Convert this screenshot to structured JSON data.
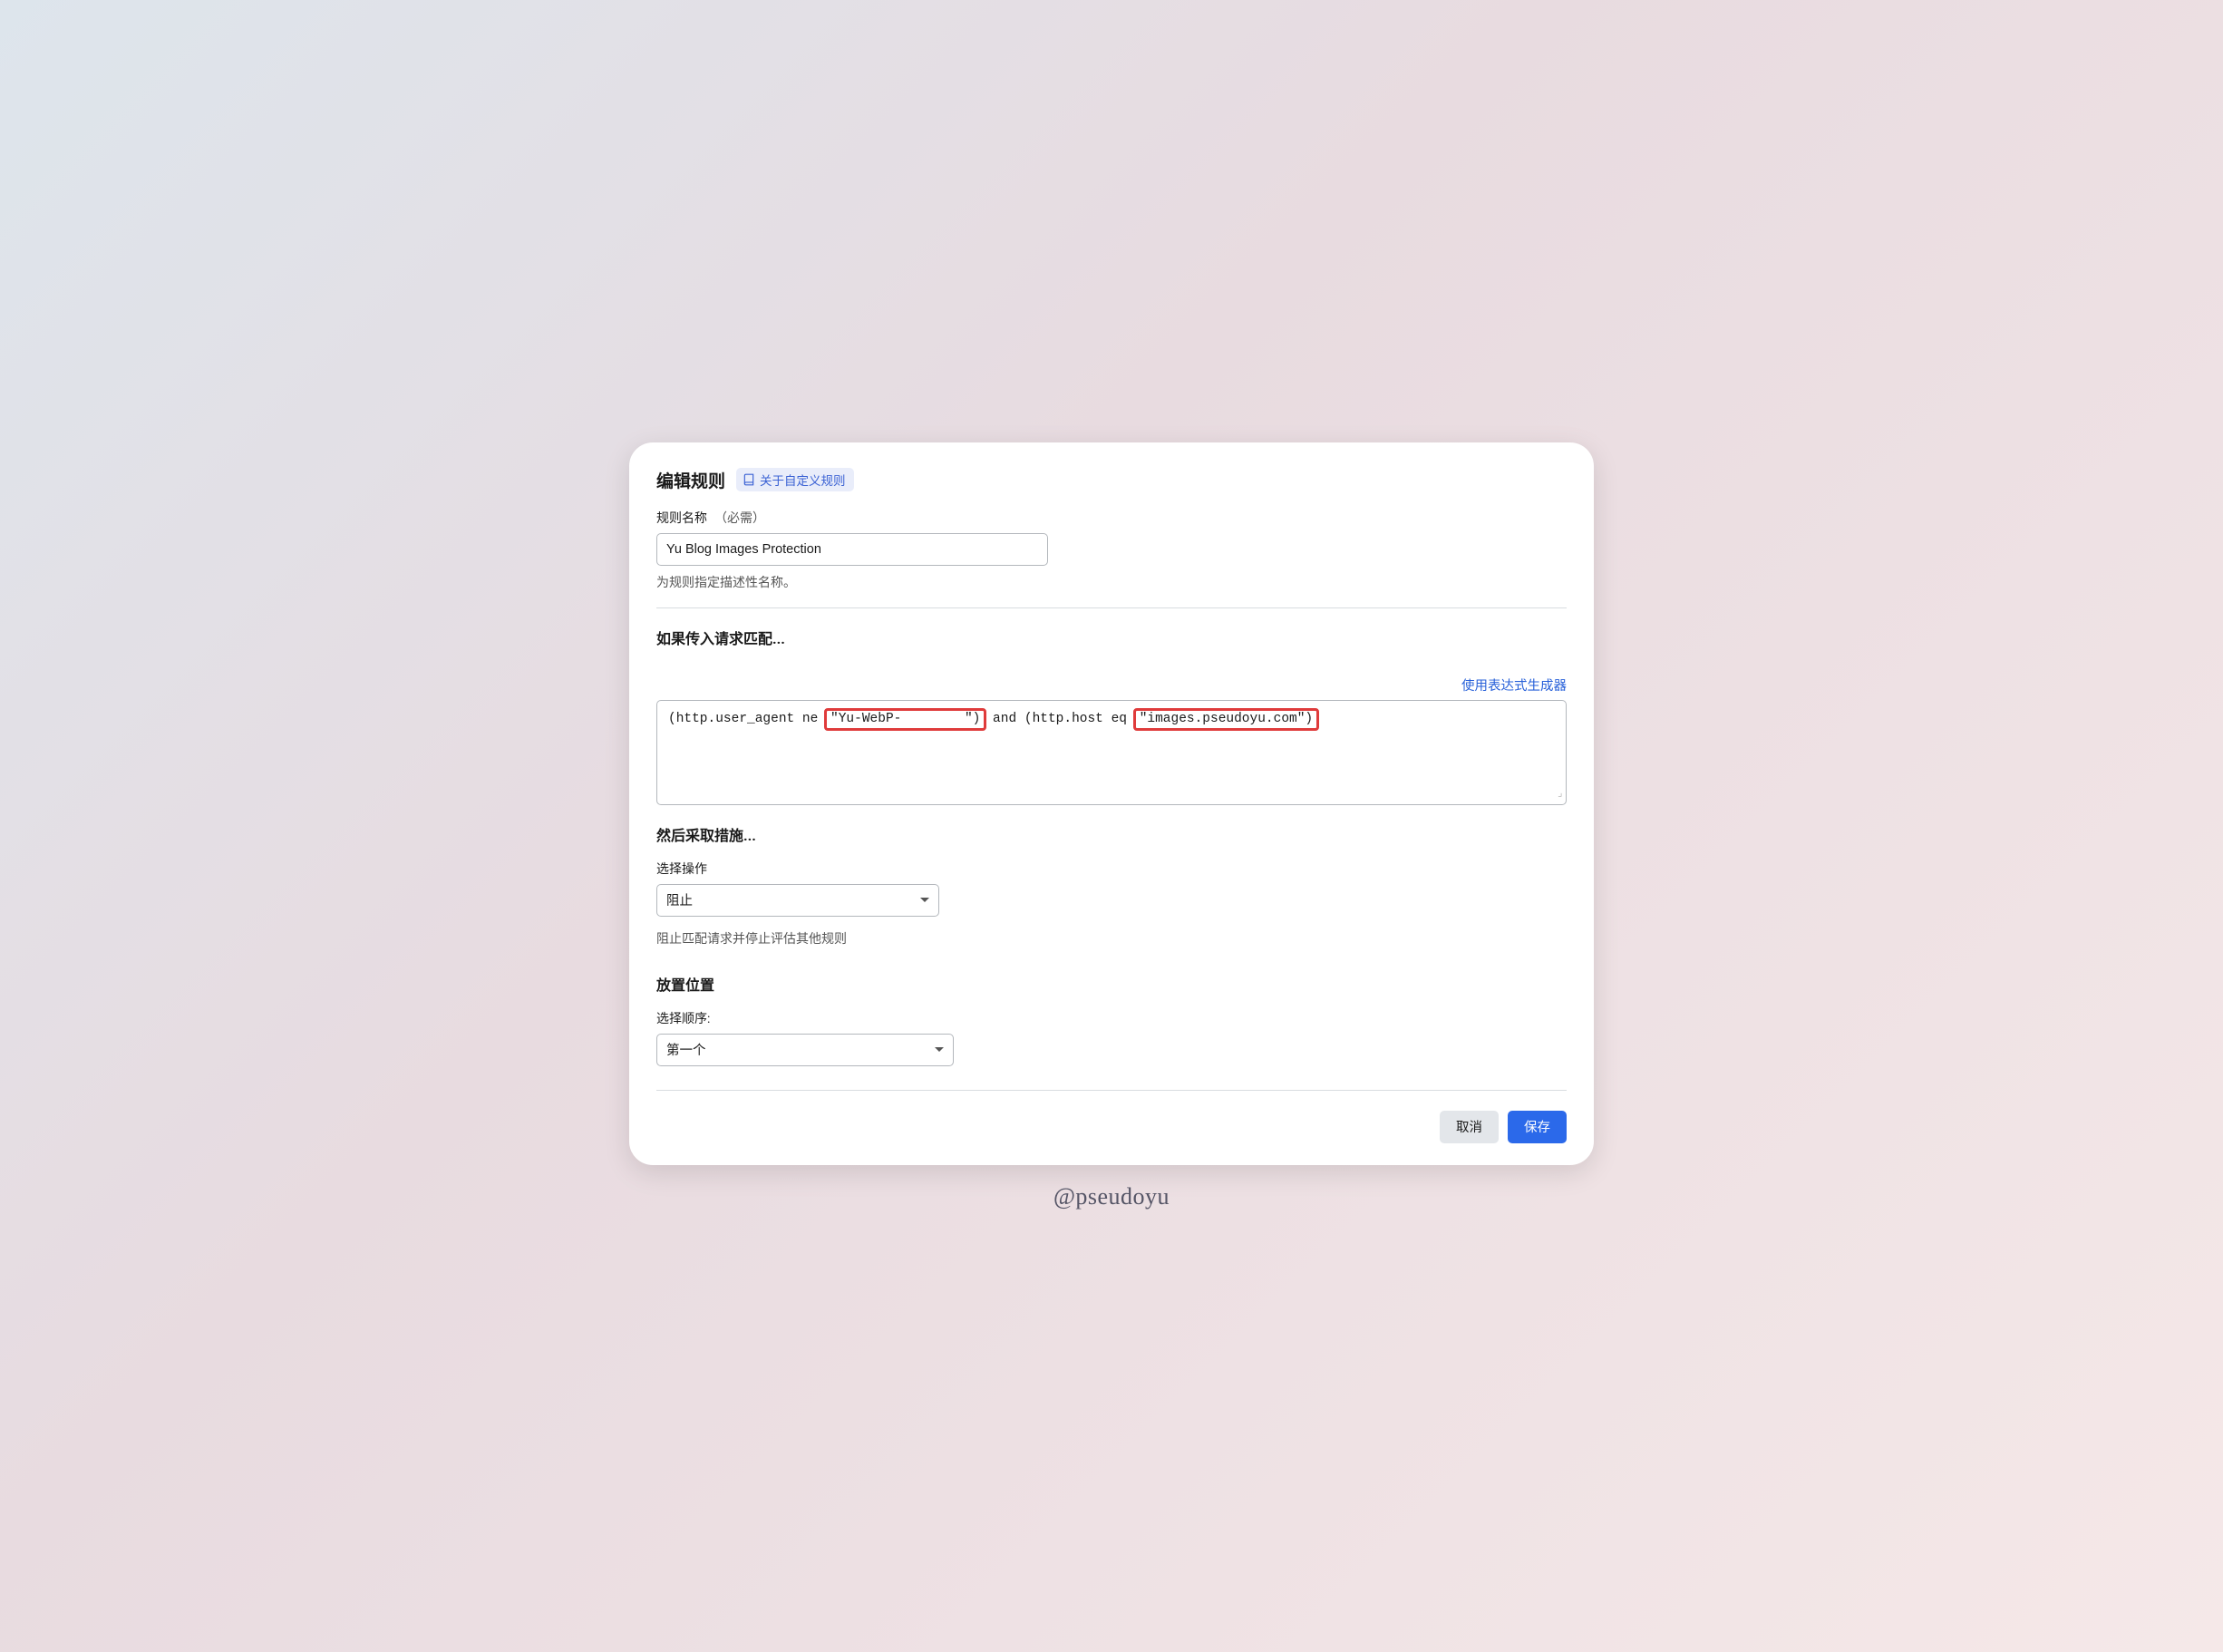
{
  "header": {
    "title": "编辑规则",
    "help_link": "关于自定义规则"
  },
  "rule_name": {
    "label": "规则名称",
    "required": "（必需）",
    "value": "Yu Blog Images Protection",
    "helper": "为规则指定描述性名称。"
  },
  "match": {
    "title": "如果传入请求匹配...",
    "builder_link": "使用表达式生成器",
    "expr_pre": "(http.user_agent ne ",
    "expr_hl1": "\"Yu-WebP-        \")",
    "expr_mid": " and (http.host eq ",
    "expr_hl2": "\"images.pseudoyu.com\")"
  },
  "action": {
    "title": "然后采取措施...",
    "select_label": "选择操作",
    "selected": "阻止",
    "helper": "阻止匹配请求并停止评估其他规则"
  },
  "placement": {
    "title": "放置位置",
    "select_label": "选择顺序:",
    "selected": "第一个"
  },
  "footer": {
    "cancel": "取消",
    "save": "保存"
  },
  "watermark": "@pseudoyu"
}
